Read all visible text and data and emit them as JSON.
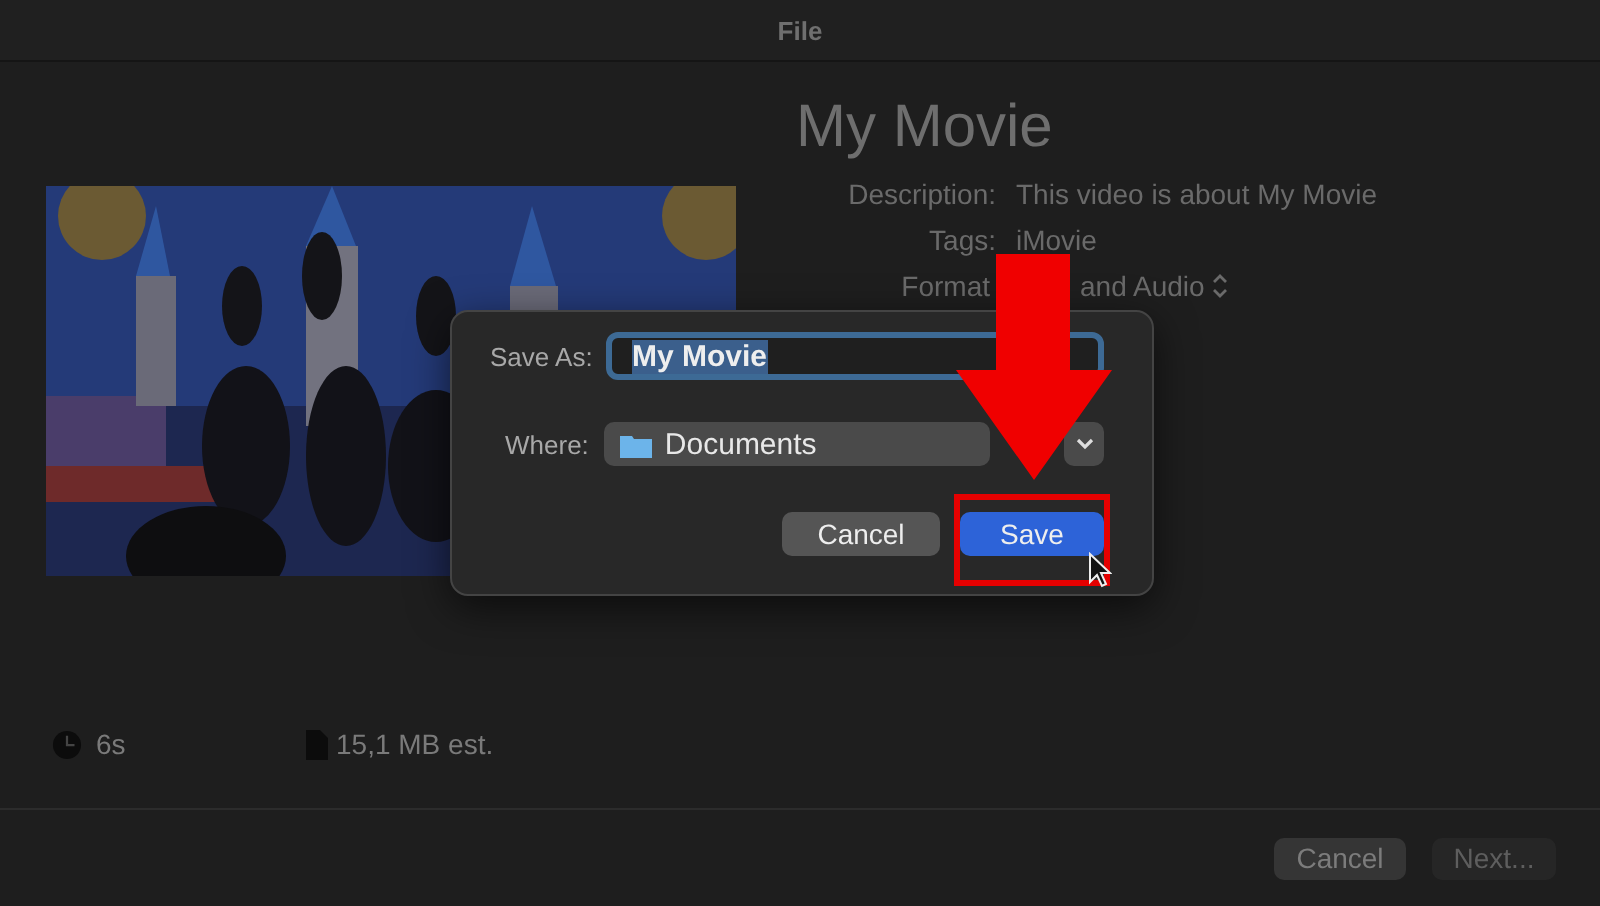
{
  "window": {
    "title": "File"
  },
  "project": {
    "title": "My Movie",
    "fields": [
      {
        "label": "Description:",
        "value": "This video is about My Movie",
        "kind": "text"
      },
      {
        "label": "Tags:",
        "value": "iMovie",
        "kind": "text"
      },
      {
        "label": "Format",
        "value": "and Audio",
        "kind": "popup"
      }
    ],
    "duration": "6s",
    "size": "15,1 MB est."
  },
  "footer": {
    "buttons": [
      {
        "label": "Cancel",
        "disabled": false
      },
      {
        "label": "Next...",
        "disabled": true
      }
    ]
  },
  "save_dialog": {
    "save_as_label": "Save As:",
    "save_as_value": "My Movie",
    "where_label": "Where:",
    "where_value": "Documents",
    "buttons": [
      {
        "label": "Cancel",
        "kind": "secondary"
      },
      {
        "label": "Save",
        "kind": "primary"
      }
    ]
  }
}
